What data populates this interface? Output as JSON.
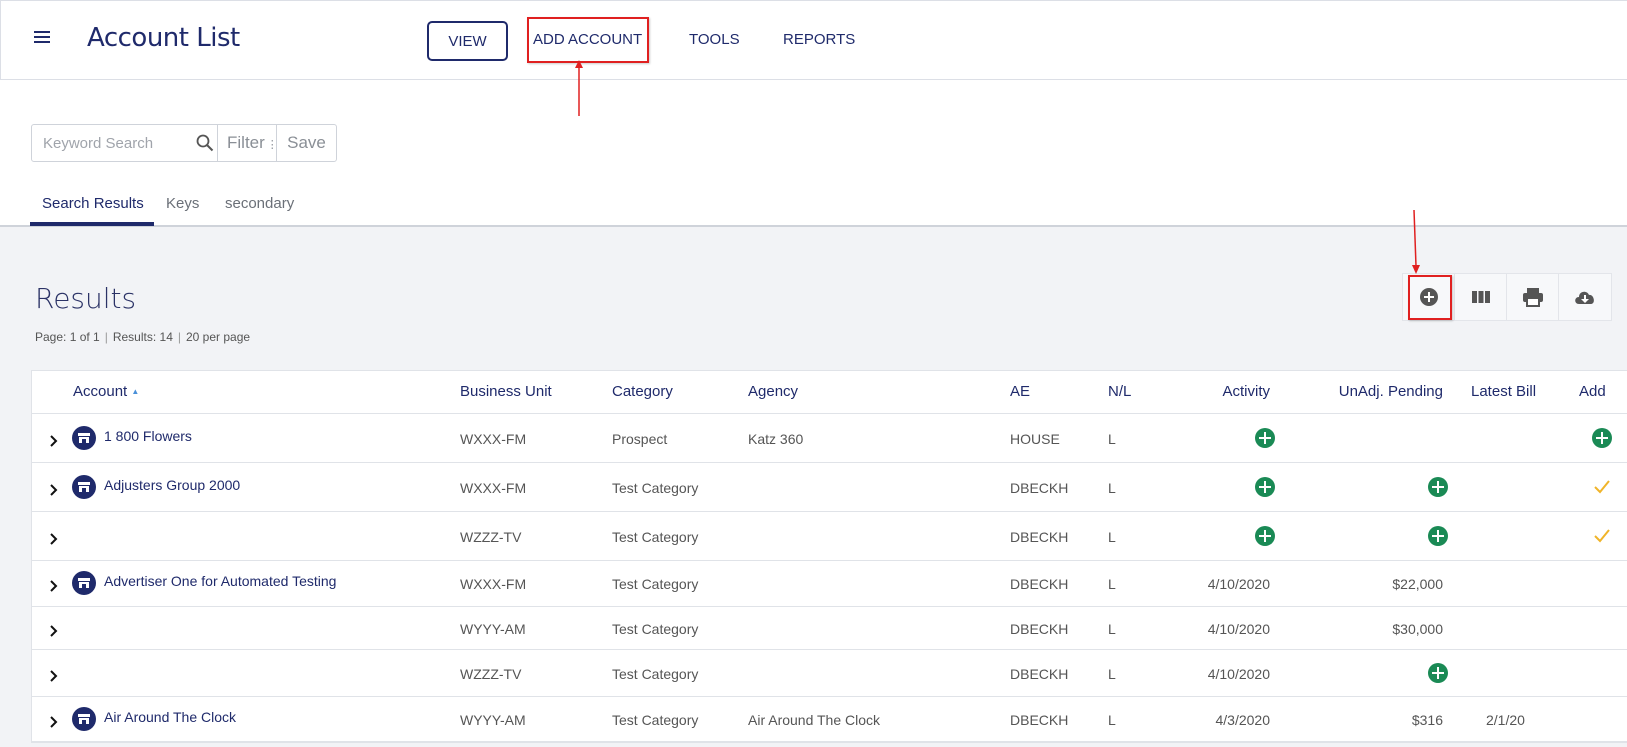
{
  "header": {
    "title": "Account List",
    "nav": {
      "view": "VIEW",
      "add_account": "ADD ACCOUNT",
      "tools": "TOOLS",
      "reports": "REPORTS"
    }
  },
  "search": {
    "placeholder": "Keyword Search",
    "filter_label": "Filter",
    "save_label": "Save"
  },
  "tabs": [
    "Search Results",
    "Keys",
    "secondary"
  ],
  "results": {
    "title": "Results",
    "page": "Page: 1 of 1",
    "count": "Results: 14",
    "per_page": "20 per page"
  },
  "toolbar": [
    "add-circle-icon",
    "columns-icon",
    "print-icon",
    "cloud-download-icon"
  ],
  "table": {
    "columns": [
      "Account",
      "Business Unit",
      "Category",
      "Agency",
      "AE",
      "N/L",
      "Activity",
      "UnAdj. Pending",
      "Latest Bill",
      "Add"
    ],
    "rows": [
      {
        "account": "1 800 Flowers",
        "unit": "WXXX-FM",
        "category": "Prospect",
        "agency": "Katz 360",
        "ae": "HOUSE",
        "nl": "L",
        "activity": "plus",
        "pending": "",
        "bill": "",
        "add": "plus"
      },
      {
        "account": "Adjusters Group 2000",
        "unit": "WXXX-FM",
        "category": "Test Category",
        "agency": "",
        "ae": "DBECKH",
        "nl": "L",
        "activity": "plus",
        "pending": "plus",
        "bill": "",
        "add": "check"
      },
      {
        "account": "",
        "unit": "WZZZ-TV",
        "category": "Test Category",
        "agency": "",
        "ae": "DBECKH",
        "nl": "L",
        "activity": "plus",
        "pending": "plus",
        "bill": "",
        "add": "check"
      },
      {
        "account": "Advertiser One for Automated Testing",
        "unit": "WXXX-FM",
        "category": "Test Category",
        "agency": "",
        "ae": "DBECKH",
        "nl": "L",
        "activity": "4/10/2020",
        "pending": "$22,000",
        "bill": "",
        "add": ""
      },
      {
        "account": "",
        "unit": "WYYY-AM",
        "category": "Test Category",
        "agency": "",
        "ae": "DBECKH",
        "nl": "L",
        "activity": "4/10/2020",
        "pending": "$30,000",
        "bill": "",
        "add": ""
      },
      {
        "account": "",
        "unit": "WZZZ-TV",
        "category": "Test Category",
        "agency": "",
        "ae": "DBECKH",
        "nl": "L",
        "activity": "4/10/2020",
        "pending": "plus",
        "bill": "",
        "add": ""
      },
      {
        "account": "Air Around The Clock",
        "unit": "WYYY-AM",
        "category": "Test Category",
        "agency": "Air Around The Clock",
        "ae": "DBECKH",
        "nl": "L",
        "activity": "4/3/2020",
        "pending": "$316",
        "bill": "2/1/20",
        "add": ""
      }
    ]
  }
}
